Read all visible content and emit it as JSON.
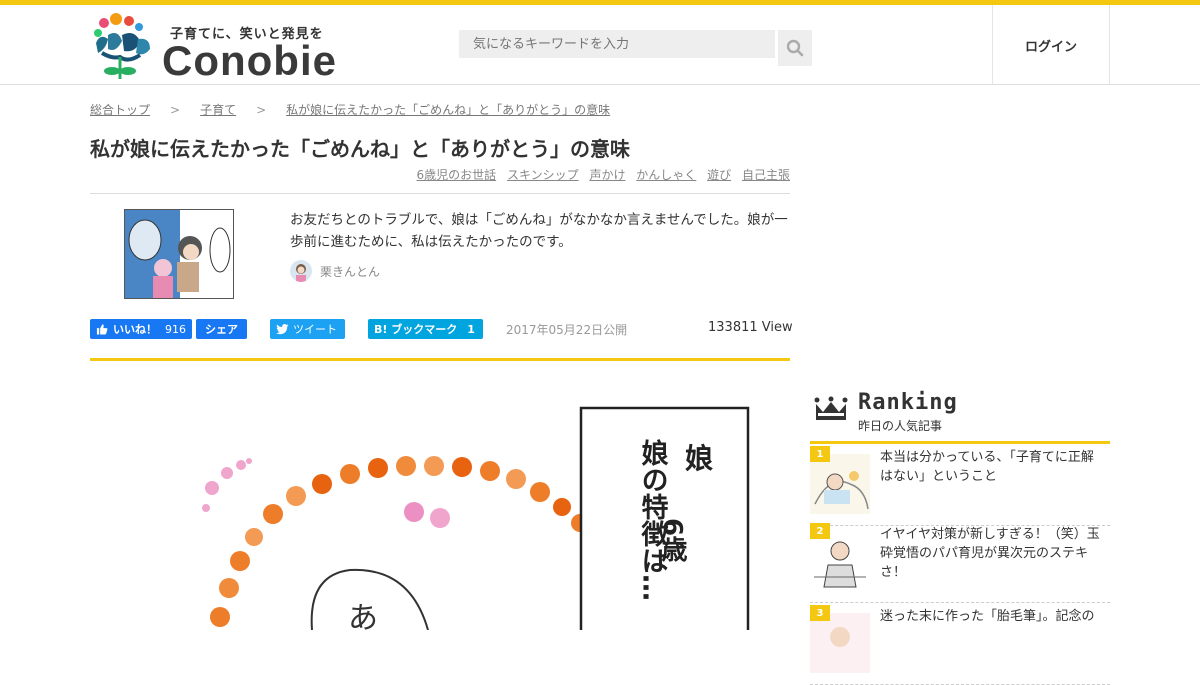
{
  "header": {
    "tagline": "子育てに、笑いと発見を",
    "brand": "Conobie",
    "search_placeholder": "気になるキーワードを入力",
    "login_label": "ログイン"
  },
  "breadcrumb": {
    "items": [
      "総合トップ",
      "子育て",
      "私が娘に伝えたかった「ごめんね」と「ありがとう」の意味"
    ],
    "separator": ">"
  },
  "article": {
    "title": "私が娘に伝えたかった「ごめんね」と「ありがとう」の意味",
    "tags": [
      "6歳児のお世話",
      "スキンシップ",
      "声かけ",
      "かんしゃく",
      "遊び",
      "自己主張"
    ],
    "lead": "お友だちとのトラブルで、娘は「ごめんね」がなかなか言えませんでした。娘が一歩前に進むために、私は伝えたかったのです。",
    "author": "栗きんとん",
    "date": "2017年05月22日公開",
    "views": "133811 View"
  },
  "social": {
    "like_label": "いいね！",
    "like_count": "916",
    "share_label": "シェア",
    "tweet_label": "ツイート",
    "hatena_label": "B! ブックマーク",
    "hatena_count": "1"
  },
  "comic": {
    "caption_line1": "娘",
    "caption_line2": "6歳",
    "caption_line3": "娘の特徴は…",
    "speech": "あ"
  },
  "ranking": {
    "title": "Ranking",
    "subtitle": "昨日の人気記事",
    "items": [
      {
        "rank": "1",
        "title": "本当は分かっている、「子育てに正解はない」ということ"
      },
      {
        "rank": "2",
        "title": "イヤイヤ対策が新しすぎる！（笑）玉砕覚悟のパパ育児が異次元のステキさ！"
      },
      {
        "rank": "3",
        "title": "迷った末に作った「胎毛筆」。記念の"
      }
    ]
  },
  "colors": {
    "accent": "#f4c710",
    "facebook": "#1877f2",
    "twitter": "#1da1f2",
    "hatena": "#00a4de"
  }
}
